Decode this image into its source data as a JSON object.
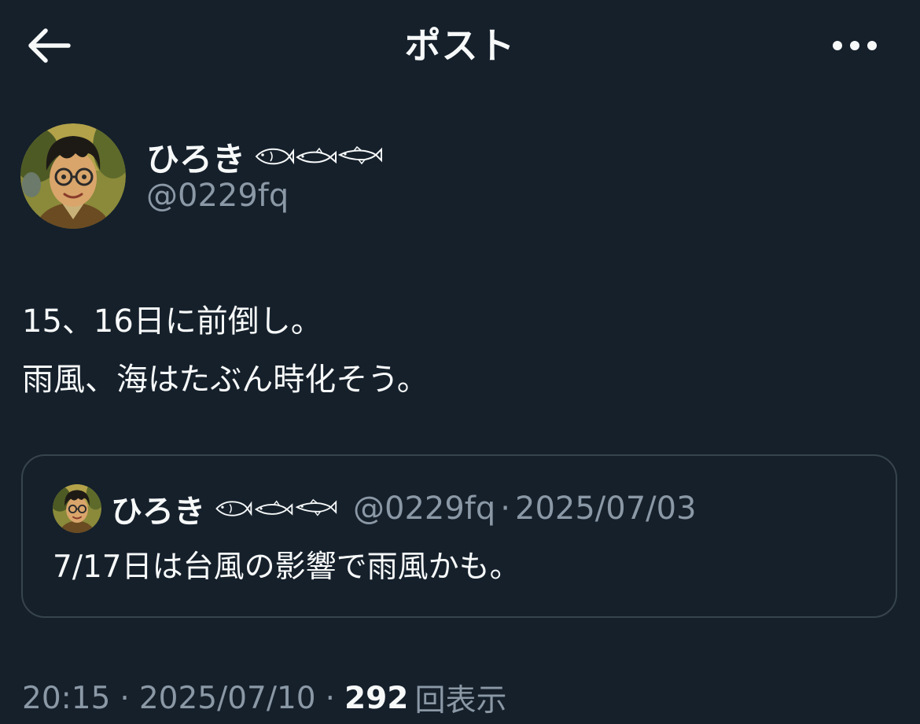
{
  "header": {
    "title": "ポスト",
    "back_icon": "arrow-left-icon",
    "more_icon": "more-horizontal-icon"
  },
  "author": {
    "name": "ひろき",
    "handle": "@0229fq",
    "name_icons": [
      "fish-icon",
      "fish-icon",
      "fish-icon"
    ]
  },
  "post": {
    "lines": [
      "15、16日に前倒し。",
      "雨風、海はたぶん時化そう。"
    ],
    "time": "20:15",
    "date": "2025/07/10",
    "separator": "·",
    "views_count": "292",
    "views_label": "回表示"
  },
  "quoted_post": {
    "name": "ひろき",
    "handle": "@0229fq",
    "separator": "·",
    "date": "2025/07/03",
    "text": "7/17日は台風の影響で雨風かも。"
  },
  "colors": {
    "background": "#15202b",
    "text_primary": "#f7f9f9",
    "text_secondary": "#8b98a5",
    "border": "#38444d"
  }
}
